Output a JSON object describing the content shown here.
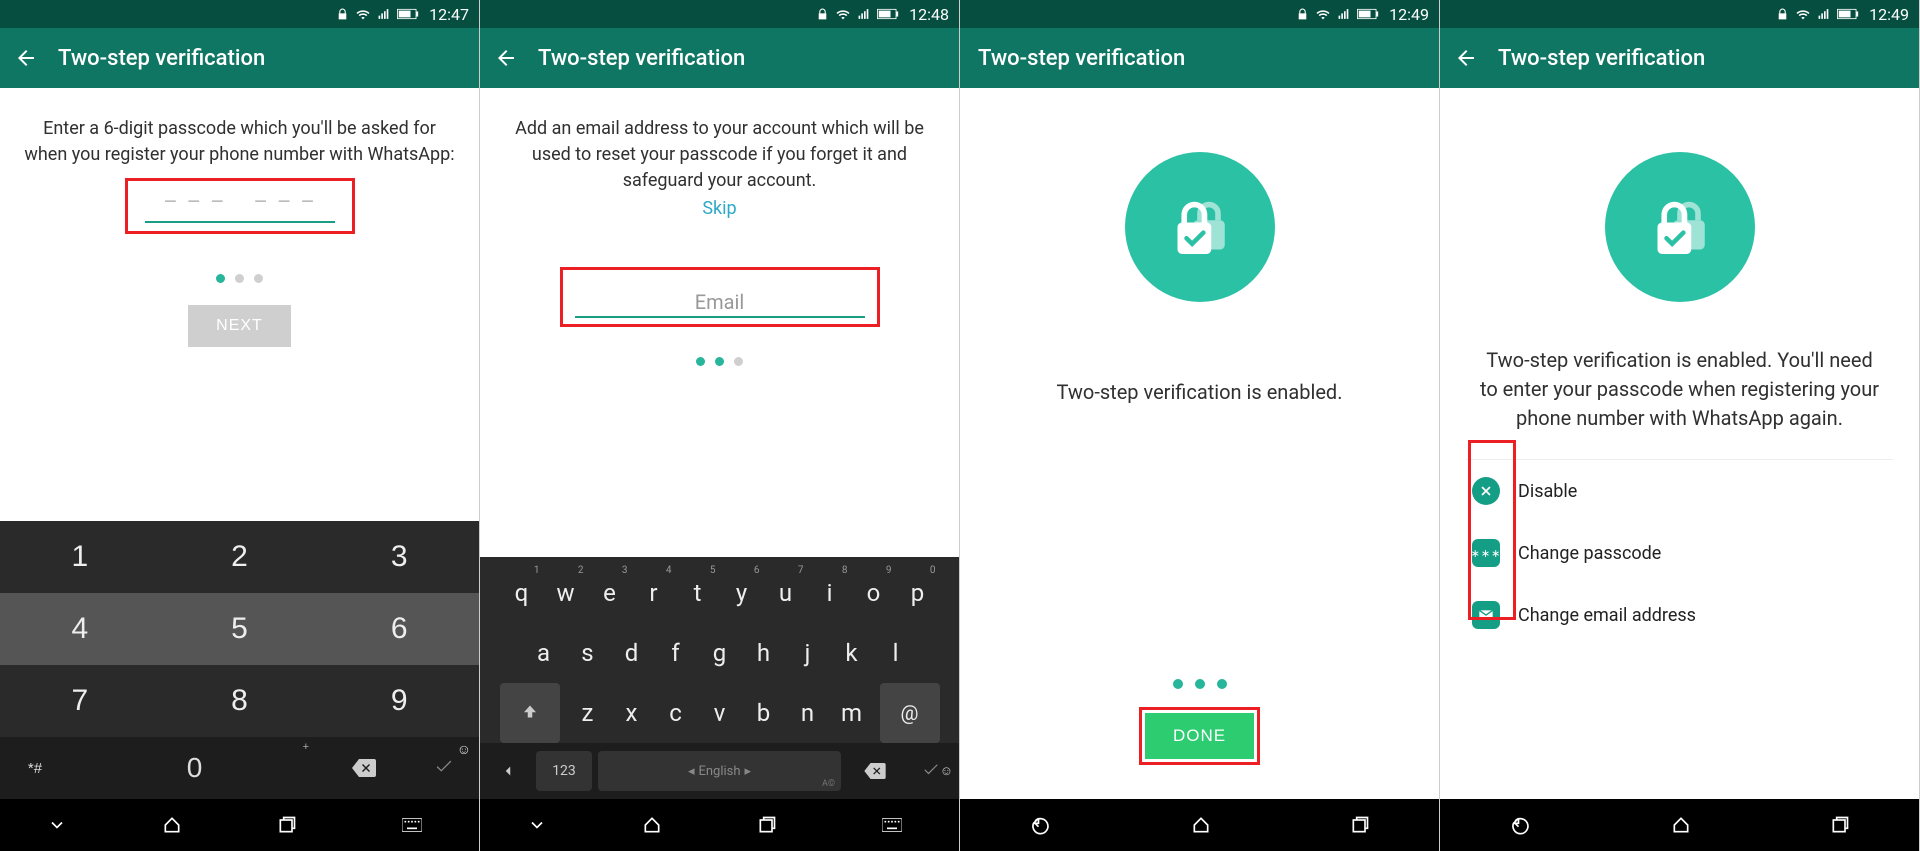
{
  "status": {
    "times": [
      "12:47",
      "12:48",
      "12:49",
      "12:49"
    ]
  },
  "appbar": {
    "title": "Two-step verification"
  },
  "panel1": {
    "instruction": "Enter a 6-digit passcode which you'll be asked for when you register your phone number with WhatsApp:",
    "next_label": "NEXT",
    "keys": {
      "r1": [
        "1",
        "2",
        "3"
      ],
      "r2": [
        "4",
        "5",
        "6"
      ],
      "r3": [
        "7",
        "8",
        "9"
      ],
      "bottom_left": "*#",
      "zero": "0"
    }
  },
  "panel2": {
    "instruction": "Add an email address to your account which will be used to reset your passcode if you forget it and safeguard your account.",
    "skip": "Skip",
    "email_placeholder": "Email",
    "keys": {
      "r1": [
        "q",
        "w",
        "e",
        "r",
        "t",
        "y",
        "u",
        "i",
        "o",
        "p"
      ],
      "r2": [
        "a",
        "s",
        "d",
        "f",
        "g",
        "h",
        "j",
        "k",
        "l"
      ],
      "r3": [
        "z",
        "x",
        "c",
        "v",
        "b",
        "n",
        "m"
      ],
      "num_label": "123",
      "lang_label": "English",
      "at": "@"
    }
  },
  "panel3": {
    "enabled_text": "Two-step verification is enabled.",
    "done_label": "DONE"
  },
  "panel4": {
    "enabled_text": "Two-step verification is enabled. You'll need to enter your passcode when registering your phone number with WhatsApp again.",
    "options": {
      "disable": "Disable",
      "change_passcode": "Change passcode",
      "change_email": "Change email address"
    }
  }
}
